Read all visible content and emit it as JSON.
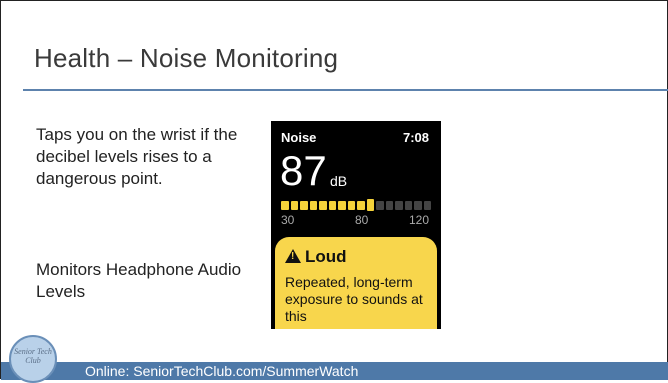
{
  "slide": {
    "title": "Health – Noise Monitoring",
    "paragraph_1": "Taps you on the wrist if the decibel levels rises to a dangerous point.",
    "paragraph_2": "Monitors Headphone Audio Levels",
    "footer": "Online: SeniorTechClub.com/SummerWatch"
  },
  "watch": {
    "app_name": "Noise",
    "time": "7:08",
    "db_value": "87",
    "db_unit": "dB",
    "ticks": [
      "30",
      "80",
      "120"
    ],
    "meter_level_fraction": 0.6,
    "alert_title": "Loud",
    "alert_message": "Repeated, long-term exposure to sounds at this"
  },
  "logo": {
    "text": "Senior Tech Club",
    "icon": "senior-tech-club-logo-icon"
  },
  "colors": {
    "accent": "#4e79a8",
    "alert": "#f8d64c",
    "meter_on": "#f5d33a"
  }
}
